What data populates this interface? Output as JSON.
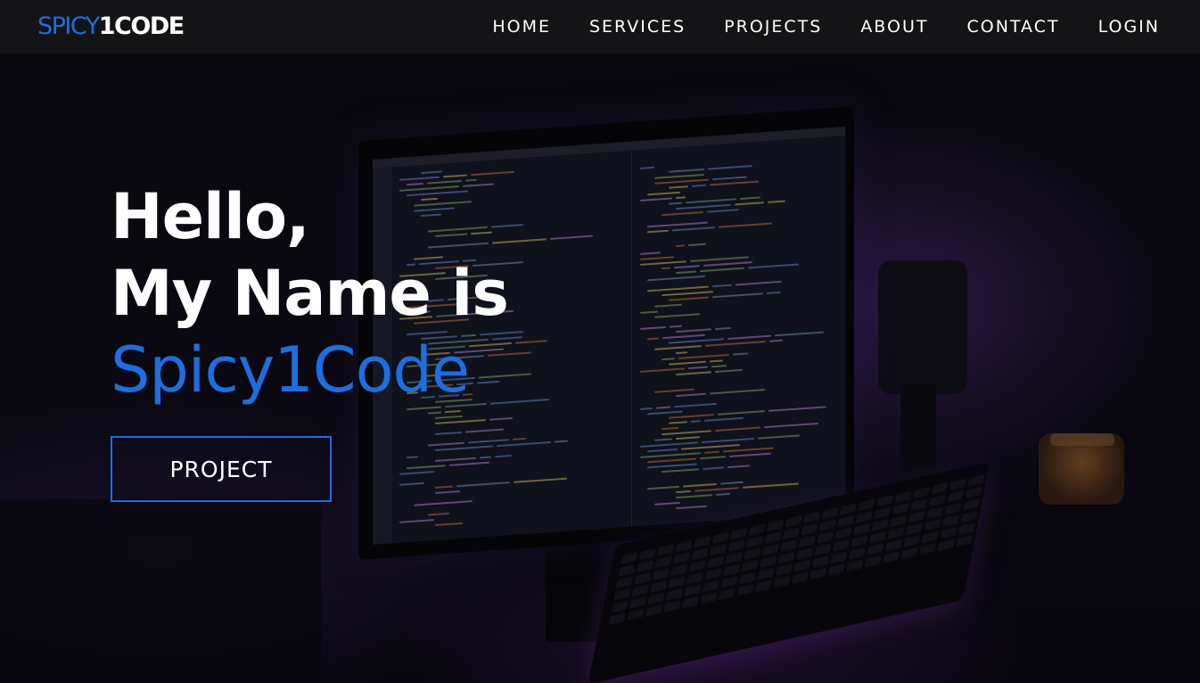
{
  "brand": {
    "accent_text": "SPICY",
    "main_text": "1CODE",
    "accent_color": "#1b6fe0"
  },
  "nav": {
    "items": [
      {
        "label": "HOME"
      },
      {
        "label": "SERVICES"
      },
      {
        "label": "PROJECTS"
      },
      {
        "label": "ABOUT"
      },
      {
        "label": "CONTACT"
      },
      {
        "label": "LOGIN"
      }
    ]
  },
  "hero": {
    "greeting": "Hello,",
    "intro": "My Name is",
    "name": "Spicy1Code",
    "button_label": "PROJECT"
  },
  "background": {
    "description_icon": "desk-monitor-image"
  }
}
